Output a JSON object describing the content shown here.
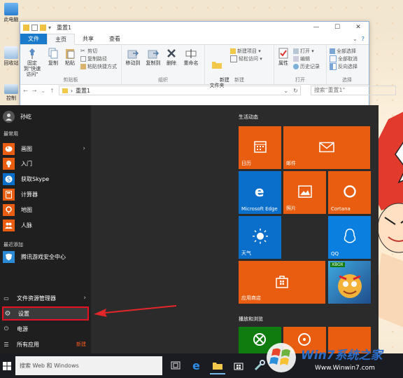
{
  "desktop": {
    "icons": [
      {
        "label": "此电脑",
        "icon": "computer-icon"
      },
      {
        "label": "回收站",
        "icon": "recycle-bin-icon"
      },
      {
        "label": "控制",
        "icon": "control-panel-icon"
      }
    ]
  },
  "explorer": {
    "title": "重置1",
    "tabs": [
      "文件",
      "主页",
      "共享",
      "查看"
    ],
    "active_tab": "主页",
    "groups": {
      "clipboard": {
        "label": "剪贴板",
        "pin": "固定到\"快速访问\"",
        "copy": "复制",
        "paste": "粘贴",
        "cut": "剪切",
        "copy_path": "复制路径",
        "paste_shortcut": "粘贴快捷方式"
      },
      "organize": {
        "label": "组织",
        "move_to": "移动到",
        "copy_to": "复制到",
        "delete": "删除",
        "rename": "重命名"
      },
      "new": {
        "label": "新建",
        "new_folder": "新建\n文件夹",
        "new_item": "新建项目 ▾",
        "easy_access": "轻松访问 ▾"
      },
      "open": {
        "label": "打开",
        "properties": "属性",
        "open": "打开 ▾",
        "edit": "编辑",
        "history": "历史记录"
      },
      "select": {
        "label": "选择",
        "select_all": "全部选择",
        "select_none": "全部取消",
        "invert": "反向选择"
      }
    },
    "address": {
      "path": "重置1",
      "search_placeholder": "搜索\"重置1\""
    }
  },
  "start": {
    "user": "孙屹",
    "most_used_label": "最常用",
    "most_used": [
      {
        "label": "画图",
        "color": "#e85d0f",
        "chev": "›"
      },
      {
        "label": "入门",
        "color": "#e85d0f"
      },
      {
        "label": "获取Skype",
        "color": "#0a6fcb"
      },
      {
        "label": "计算器",
        "color": "#e85d0f"
      },
      {
        "label": "地图",
        "color": "#e85d0f"
      },
      {
        "label": "人脉",
        "color": "#e85d0f"
      }
    ],
    "recent_label": "最近添加",
    "recent": [
      {
        "label": "腾讯游戏安全中心",
        "color": "#2a8ad6"
      }
    ],
    "bottom": {
      "explorer": "文件资源管理器",
      "settings": "设置",
      "power": "电源",
      "all_apps": "所有应用",
      "new_badge": "新建"
    },
    "group1_title": "生活动态",
    "group2_title": "播放和浏览",
    "tiles": {
      "calendar": "日历",
      "mail": "邮件",
      "edge": "Microsoft Edge",
      "photos": "照片",
      "cortana": "Cortana",
      "weather": "天气",
      "qq": "QQ",
      "store": "应用商店",
      "xbox_tag": "XBOX"
    }
  },
  "taskbar": {
    "search_placeholder": "搜索 Web 和 Windows"
  },
  "watermark": {
    "brand": "Win7系统之家",
    "url": "Www.Winwin7.com"
  },
  "colors": {
    "accent": "#e85d0f",
    "tile_blue": "#0a6fcb",
    "highlight": "#e81123"
  }
}
